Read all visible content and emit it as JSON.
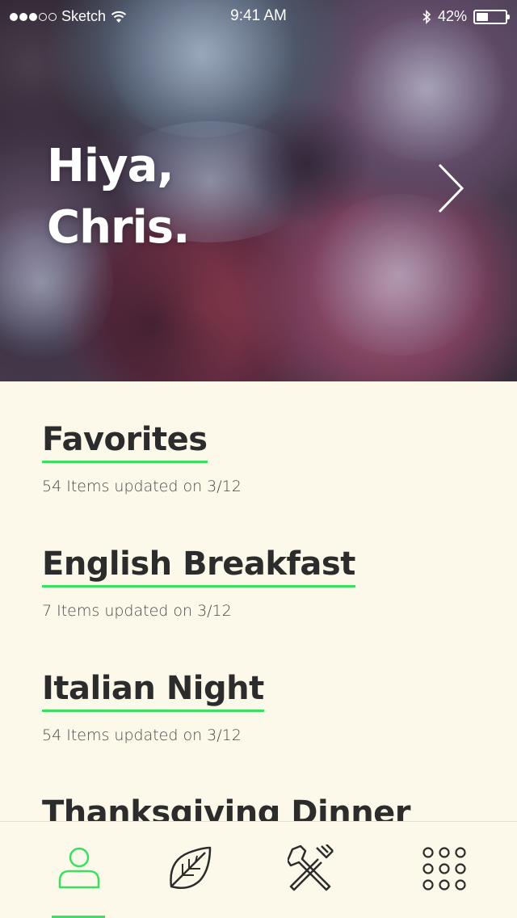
{
  "status_bar": {
    "carrier": "Sketch",
    "time": "9:41 AM",
    "battery": "42%",
    "battery_level": 0.42
  },
  "hero": {
    "greeting_line1": "Hiya,",
    "greeting_line2": "Chris.",
    "next_icon": "chevron-right-icon"
  },
  "lists": [
    {
      "title": "Favorites",
      "meta": "54 Items updated on 3/12"
    },
    {
      "title": "English Breakfast",
      "meta": "7 Items updated on 3/12"
    },
    {
      "title": "Italian Night",
      "meta": "54 Items updated on 3/12"
    },
    {
      "title": "Thanksgiving Dinner",
      "meta": ""
    }
  ],
  "tab_bar": {
    "tabs": [
      {
        "icon": "person-icon",
        "active": true
      },
      {
        "icon": "leaf-icon",
        "active": false
      },
      {
        "icon": "fork-knife-icon",
        "active": false
      },
      {
        "icon": "grid-icon",
        "active": false
      }
    ]
  },
  "colors": {
    "accent": "#3be05e",
    "background": "#fcf9ea",
    "text": "#2c2c2c"
  }
}
